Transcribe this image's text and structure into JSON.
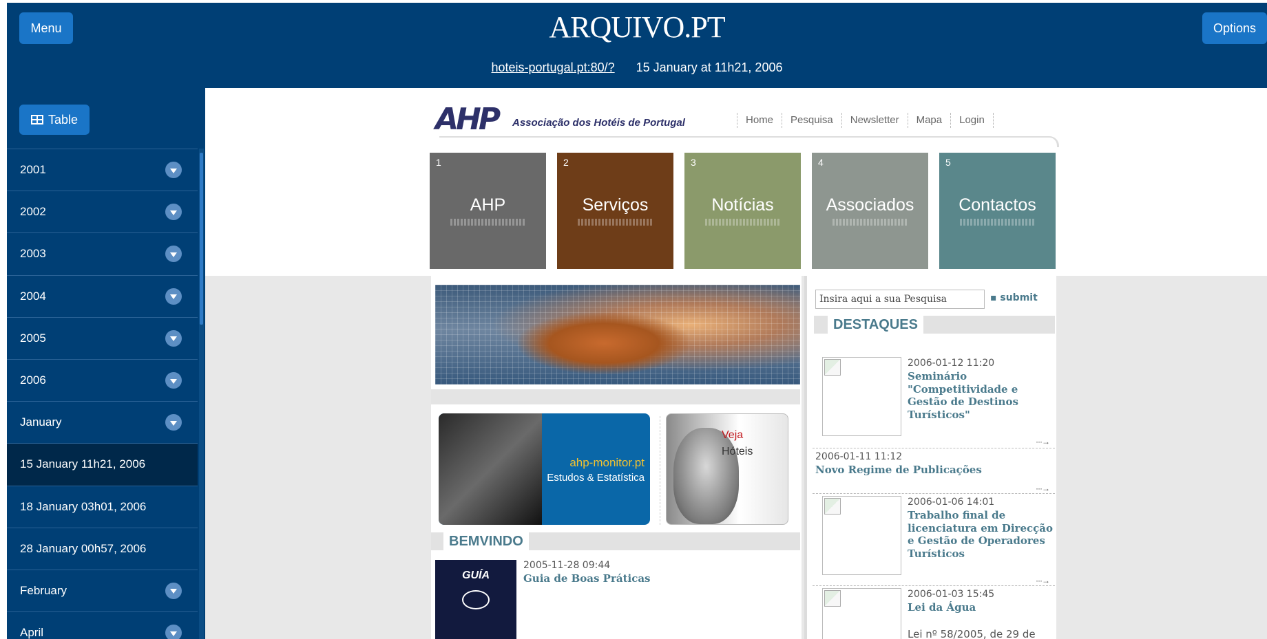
{
  "header": {
    "menu_label": "Menu",
    "logo_text": "ARQUIVO.PT",
    "options_label": "Options",
    "archived_url": "hoteis-portugal.pt:80/?",
    "capture_datetime": "15 January at 11h21, 2006"
  },
  "sidebar": {
    "table_label": "Table",
    "items": [
      {
        "label": "2001",
        "expandable": true
      },
      {
        "label": "2002",
        "expandable": true
      },
      {
        "label": "2003",
        "expandable": true
      },
      {
        "label": "2004",
        "expandable": true
      },
      {
        "label": "2005",
        "expandable": true
      },
      {
        "label": "2006",
        "expandable": true
      },
      {
        "label": "January",
        "expandable": true
      },
      {
        "label": "15 January 11h21, 2006",
        "expandable": false,
        "selected": true
      },
      {
        "label": "18 January 03h01, 2006",
        "expandable": false
      },
      {
        "label": "28 January 00h57, 2006",
        "expandable": false
      },
      {
        "label": "February",
        "expandable": true
      },
      {
        "label": "April",
        "expandable": true
      }
    ]
  },
  "site": {
    "logo": "AHP",
    "logo_subtitle": "Associação dos Hotéis de Portugal",
    "nav": [
      "Home",
      "Pesquisa",
      "Newsletter",
      "Mapa",
      "Login"
    ],
    "tiles": [
      {
        "num": "1",
        "label": "AHP",
        "color": "#696969"
      },
      {
        "num": "2",
        "label": "Serviços",
        "color": "#6e3d18"
      },
      {
        "num": "3",
        "label": "Notícias",
        "color": "#8b9a6b"
      },
      {
        "num": "4",
        "label": "Associados",
        "color": "#8e9690"
      },
      {
        "num": "5",
        "label": "Contactos",
        "color": "#5a878b"
      }
    ],
    "banner_monitor": {
      "line1": "ahp-monitor.pt",
      "line2": "Estudos & Estatística"
    },
    "banner_veja": {
      "line1": "Veja",
      "line2": "Hóteis"
    },
    "bemvindo": {
      "heading": "BEMVINDO",
      "book_title": "GUÍA",
      "date": "2005-11-28 09:44",
      "title": "Guia de Boas Práticas"
    },
    "search": {
      "placeholder": "Insira aqui a sua Pesquisa",
      "submit": "submit"
    },
    "destaques": {
      "heading": "DESTAQUES",
      "items": [
        {
          "date": "2006-01-12 11:20",
          "title": "Seminário \"Competitividade e Gestão de Destinos Turísticos\""
        },
        {
          "date": "2006-01-11 11:12",
          "title": "Novo Regime de Publicações"
        },
        {
          "date": "2006-01-06 14:01",
          "title": "Trabalho final de licenciatura em Direcção e Gestão de Operadores Turísticos"
        },
        {
          "date": "2006-01-03 15:45",
          "title": "Lei da Água",
          "excerpt": "Lei nº 58/2005, de 29 de"
        }
      ],
      "more_label": "···→"
    }
  }
}
